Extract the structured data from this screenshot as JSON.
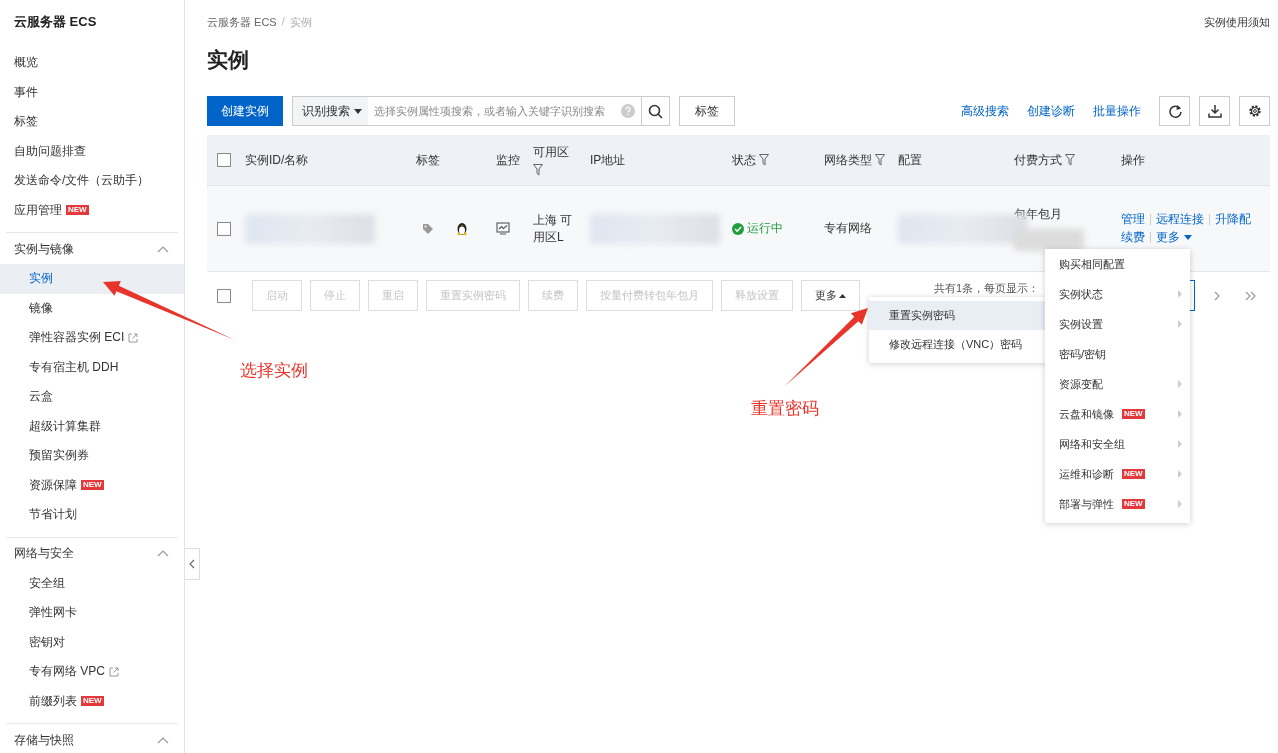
{
  "sidebar": {
    "title": "云服务器 ECS",
    "sections": [
      {
        "items": [
          {
            "label": "概览",
            "selected": false,
            "external": false
          },
          {
            "label": "事件",
            "selected": false,
            "external": false
          },
          {
            "label": "标签",
            "selected": false,
            "external": false
          },
          {
            "label": "自助问题排查",
            "selected": false,
            "external": false
          },
          {
            "label": "发送命令/文件（云助手）",
            "selected": false,
            "external": false
          },
          {
            "label": "应用管理",
            "selected": false,
            "external": false,
            "badge": "NEW"
          }
        ]
      },
      {
        "label": "实例与镜像",
        "expanded": true,
        "items": [
          {
            "label": "实例",
            "selected": true,
            "external": false
          },
          {
            "label": "镜像",
            "selected": false,
            "external": false
          },
          {
            "label": "弹性容器实例 ECI",
            "selected": false,
            "external": true
          },
          {
            "label": "专有宿主机 DDH",
            "selected": false,
            "external": false
          },
          {
            "label": "云盒",
            "selected": false,
            "external": false
          },
          {
            "label": "超级计算集群",
            "selected": false,
            "external": false
          },
          {
            "label": "预留实例券",
            "selected": false,
            "external": false
          },
          {
            "label": "资源保障",
            "selected": false,
            "external": false,
            "badge": "NEW"
          },
          {
            "label": "节省计划",
            "selected": false,
            "external": false
          }
        ]
      },
      {
        "label": "网络与安全",
        "expanded": true,
        "items": [
          {
            "label": "安全组",
            "selected": false,
            "external": false
          },
          {
            "label": "弹性网卡",
            "selected": false,
            "external": false
          },
          {
            "label": "密钥对",
            "selected": false,
            "external": false
          },
          {
            "label": "专有网络 VPC",
            "selected": false,
            "external": true
          },
          {
            "label": "前缀列表",
            "selected": false,
            "external": false,
            "badge": "NEW"
          }
        ]
      },
      {
        "label": "存储与快照",
        "expanded": true
      }
    ]
  },
  "breadcrumb": [
    {
      "label": "云服务器 ECS"
    },
    {
      "label": "实例"
    }
  ],
  "breadcrumb_separator": "/",
  "help_link": "实例使用须知",
  "page_title": "实例",
  "toolbar": {
    "create_button": "创建实例",
    "search": {
      "scope": "识别搜索",
      "placeholder": "选择实例属性项搜索，或者输入关键字识别搜索"
    },
    "tag_button": "标签",
    "links": [
      "高级搜索",
      "创建诊断",
      "批量操作"
    ]
  },
  "table": {
    "columns": [
      {
        "label": "实例ID/名称",
        "filter": false
      },
      {
        "label": "标签",
        "filter": false
      },
      {
        "label": "监控",
        "filter": false
      },
      {
        "label": "可用区",
        "filter": true
      },
      {
        "label": "IP地址",
        "filter": false
      },
      {
        "label": "状态",
        "filter": true
      },
      {
        "label": "网络类型",
        "filter": true
      },
      {
        "label": "配置",
        "filter": false
      },
      {
        "label": "付费方式",
        "filter": true
      },
      {
        "label": "操作",
        "filter": false
      }
    ],
    "header_checked": false,
    "rows": [
      {
        "checked": false,
        "cells": [
          {
            "kind": "redacted"
          },
          {
            "kind": "tags"
          },
          {
            "kind": "monitor"
          },
          {
            "kind": "text",
            "text": "上海 可用区L"
          },
          {
            "kind": "redacted"
          },
          {
            "kind": "status",
            "text": "运行中"
          },
          {
            "kind": "text",
            "text": "专有网络"
          },
          {
            "kind": "redacted"
          },
          {
            "kind": "billing",
            "text": "包年包月"
          },
          {
            "kind": "actions",
            "lines": [
              [
                "管理",
                "远程连接",
                "升降配"
              ],
              [
                "续费",
                "更多"
              ]
            ]
          }
        ]
      }
    ]
  },
  "batch_bar": {
    "checked": false,
    "buttons": [
      {
        "label": "启动",
        "disabled": true
      },
      {
        "label": "停止",
        "disabled": true
      },
      {
        "label": "重启",
        "disabled": true
      },
      {
        "label": "重置实例密码",
        "disabled": true
      },
      {
        "label": "续费",
        "disabled": true
      },
      {
        "label": "按量付费转包年包月",
        "disabled": true
      },
      {
        "label": "释放设置",
        "disabled": true
      }
    ],
    "more_button": {
      "label": "更多",
      "expanded": true
    },
    "summary": "共有1条，每页显示："
  },
  "more_menu": {
    "items": [
      {
        "label": "重置实例密码",
        "selected": true
      },
      {
        "label": "修改远程连接（VNC）密码",
        "selected": false
      }
    ]
  },
  "row_menu": {
    "items": [
      {
        "label": "购买相同配置",
        "submenu": false
      },
      {
        "label": "实例状态",
        "submenu": true
      },
      {
        "label": "实例设置",
        "submenu": true
      },
      {
        "label": "密码/密钥",
        "submenu": false
      },
      {
        "label": "资源变配",
        "submenu": true
      },
      {
        "label": "云盘和镜像",
        "submenu": true,
        "badge": "NEW"
      },
      {
        "label": "网络和安全组",
        "submenu": true
      },
      {
        "label": "运维和诊断",
        "submenu": true,
        "badge": "NEW"
      },
      {
        "label": "部署与弹性",
        "submenu": true,
        "badge": "NEW"
      }
    ]
  },
  "annotations": [
    {
      "text": "选择实例"
    },
    {
      "text": "重置密码"
    }
  ]
}
